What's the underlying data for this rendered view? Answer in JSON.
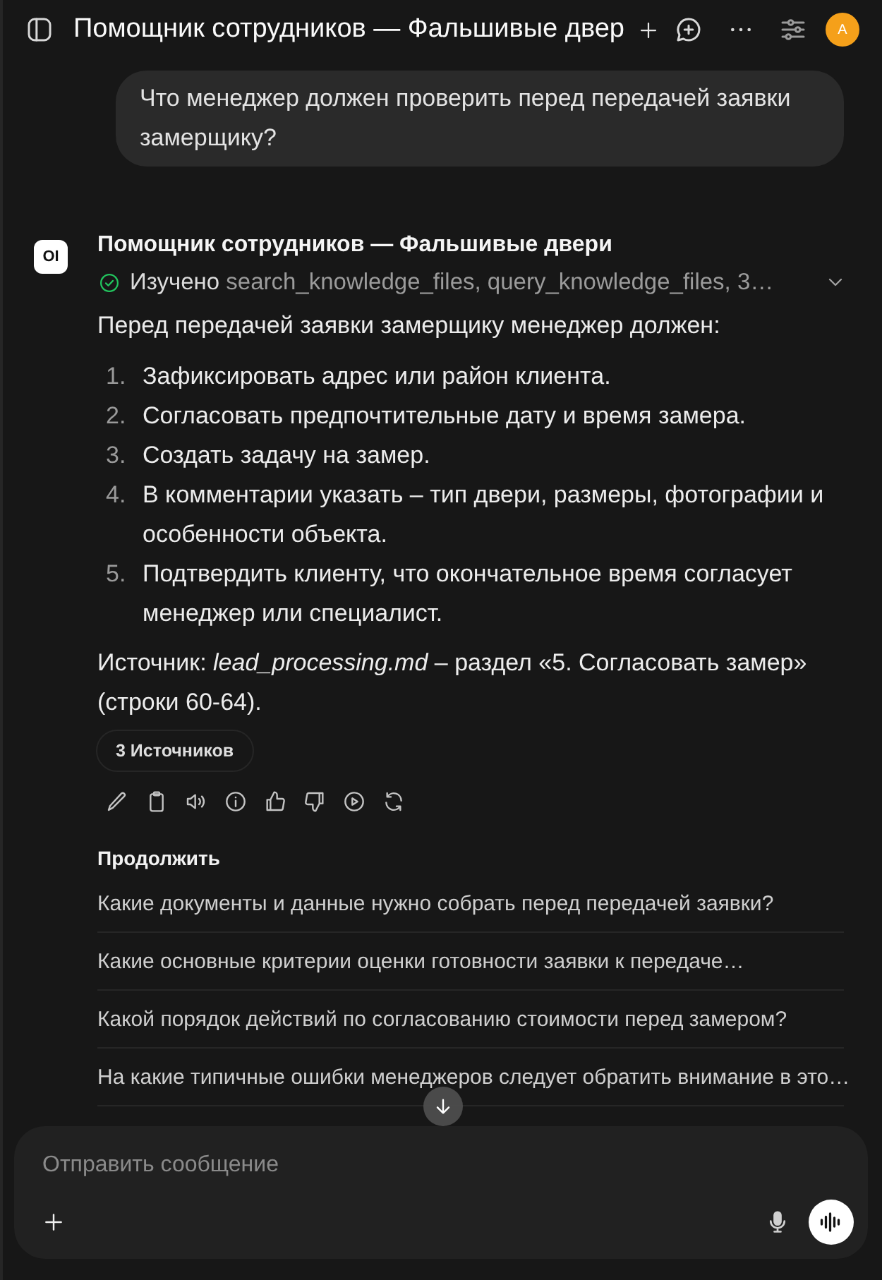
{
  "header": {
    "title": "Помощник сотрудников — Фальшивые двер",
    "avatar": "A"
  },
  "user_message": {
    "text": "Что менеджер должен проверить перед передачей заявки замерщику?"
  },
  "assistant": {
    "logo": "OI",
    "name": "Помощник сотрудников — Фальшивые двери",
    "status": {
      "label": "Изучено",
      "detail": "search_knowledge_files, query_knowledge_files, 3…"
    },
    "intro": "Перед передачей заявки замерщику менеджер должен:",
    "steps": [
      {
        "number": "1.",
        "text": "Зафиксировать адрес или район клиента."
      },
      {
        "number": "2.",
        "text": "Согласовать предпочтительные дату и время замера."
      },
      {
        "number": "3.",
        "text": "Создать задачу на замер."
      },
      {
        "number": "4.",
        "text": "В комментарии указать – тип двери, размеры, фотографии и особенности объекта."
      },
      {
        "number": "5.",
        "text": "Подтвердить клиенту, что окончательное время согласует менеджер или специалист."
      }
    ],
    "source": "Источник: *lead_processing.md* – раздел «5. Согласовать замер» (строки 60-64).",
    "sources_button": "3 Источников"
  },
  "follow_ups": {
    "title": "Продолжить",
    "items": [
      "Какие документы и данные нужно собрать перед передачей заявки?",
      "Какие основные критерии оценки готовности заявки к передаче…",
      "Какой порядок действий по согласованию стоимости перед замером?",
      "На какие типичные ошибки менеджеров следует обратить внимание в это…"
    ]
  },
  "composer": {
    "placeholder": "Отправить сообщение"
  }
}
